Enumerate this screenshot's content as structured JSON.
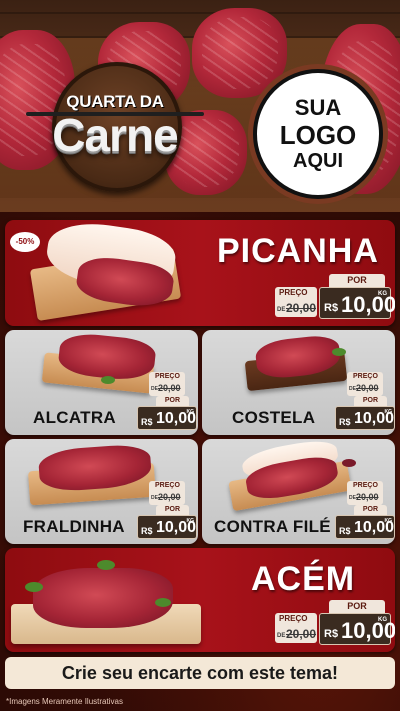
{
  "header": {
    "badge_top": "QUARTA DA",
    "badge_main": "Carne",
    "logo": [
      "SUA",
      "LOGO",
      "AQUI"
    ]
  },
  "featured": {
    "discount": "-50%",
    "name": "PICANHA",
    "por": "POR",
    "preco": "PREÇO",
    "de": "DE",
    "old": "20,00",
    "currency": "R$",
    "new": "10,00",
    "kg": "KG"
  },
  "products": [
    {
      "name": "ALCATRA",
      "preco": "PREÇO",
      "de": "DE",
      "old": "20,00",
      "por": "POR",
      "currency": "R$",
      "new": "10,00",
      "kg": "KG"
    },
    {
      "name": "COSTELA",
      "preco": "PREÇO",
      "de": "DE",
      "old": "20,00",
      "por": "POR",
      "currency": "R$",
      "new": "10,00",
      "kg": "KG"
    },
    {
      "name": "FRALDINHA",
      "preco": "PREÇO",
      "de": "DE",
      "old": "20,00",
      "por": "POR",
      "currency": "R$",
      "new": "10,00",
      "kg": "KG"
    },
    {
      "name": "CONTRA FILÉ",
      "preco": "PREÇO",
      "de": "DE",
      "old": "20,00",
      "por": "POR",
      "currency": "R$",
      "new": "10,00",
      "kg": "KG"
    }
  ],
  "bottom": {
    "name": "ACÉM",
    "por": "POR",
    "preco": "PREÇO",
    "de": "DE",
    "old": "20,00",
    "currency": "R$",
    "new": "10,00",
    "kg": "KG"
  },
  "cta": "Crie seu encarte com este tema!",
  "disclaimer": "*Imagens Meramente Ilustrativas",
  "colors": {
    "red": "#a8121a",
    "grey": "#c9c9c9",
    "dark": "#3a2b20",
    "cream": "#f4e8d7"
  }
}
